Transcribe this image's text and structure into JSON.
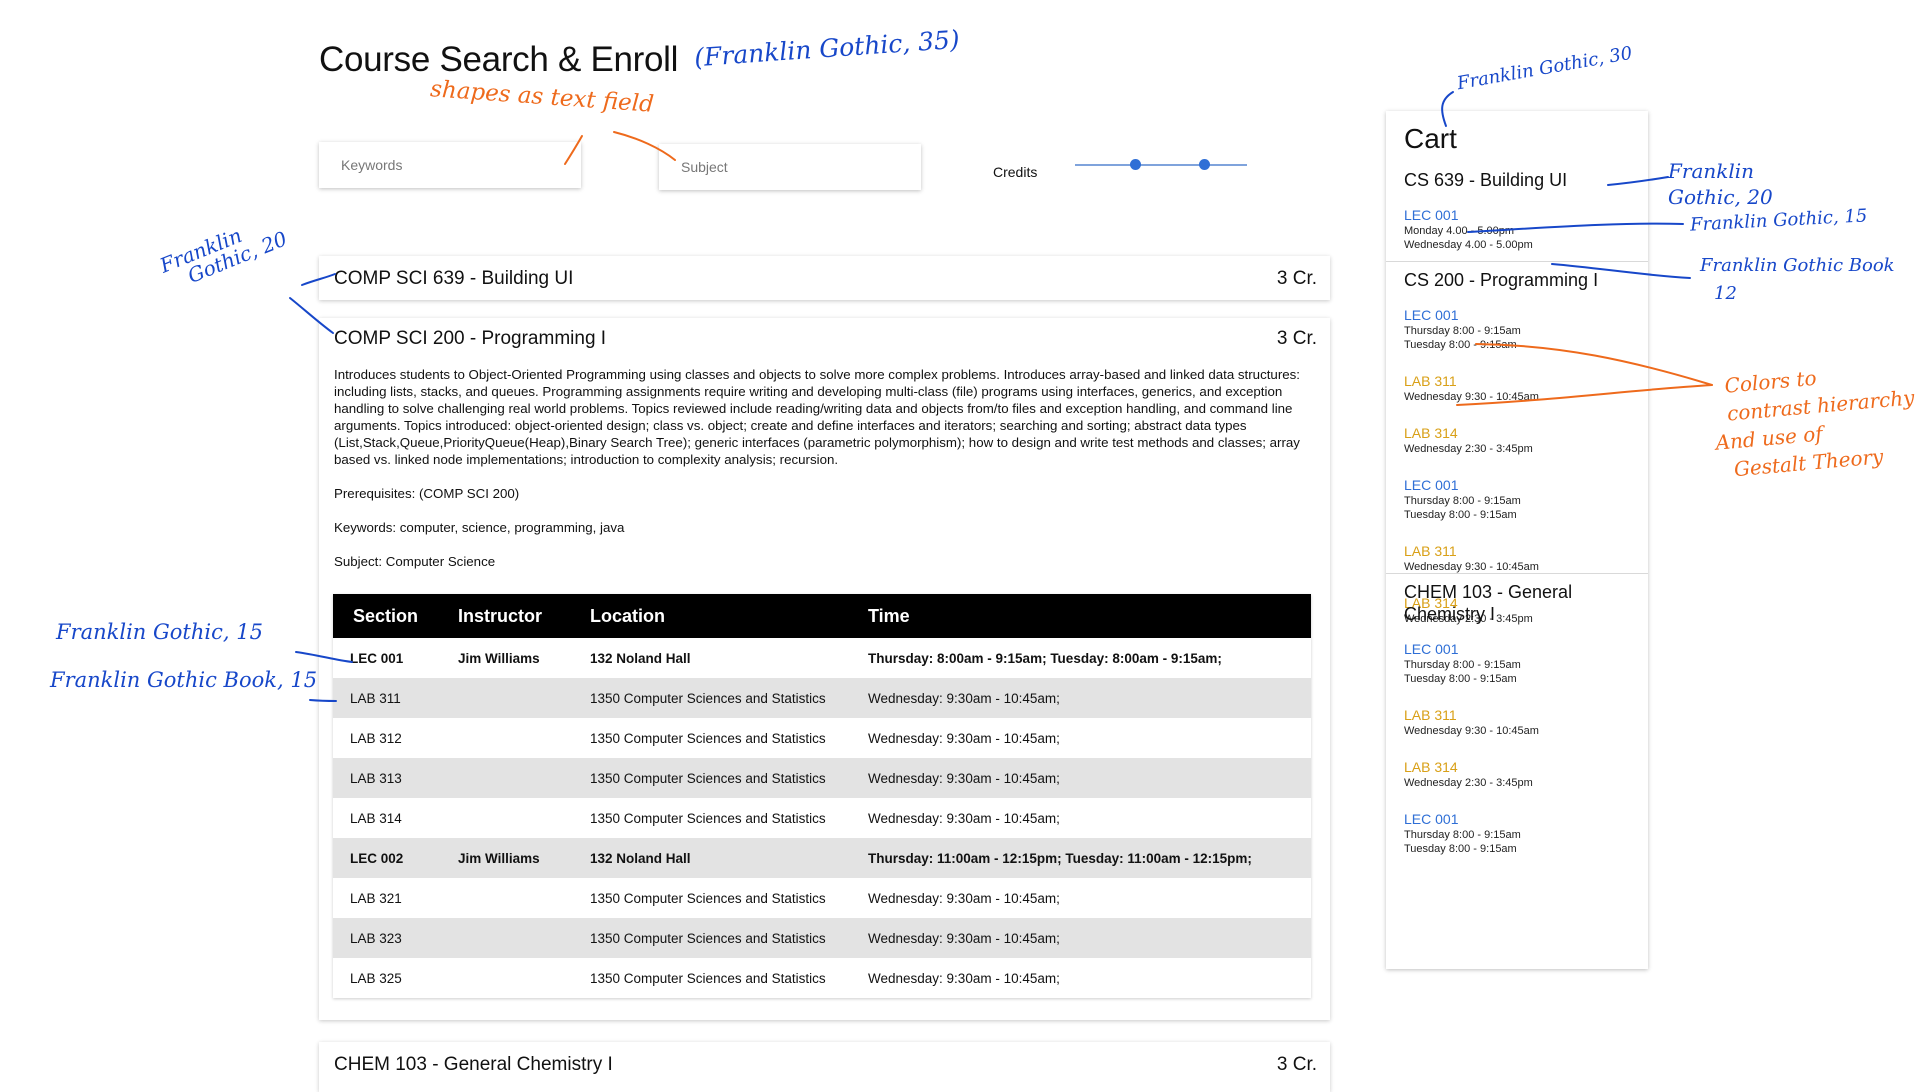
{
  "page": {
    "title": "Course Search & Enroll",
    "keywords_placeholder": "Keywords",
    "subject_placeholder": "Subject",
    "credits_label": "Credits",
    "credits_range": [
      0.35,
      0.75
    ]
  },
  "courses": [
    {
      "name": "COMP SCI 639 - Building UI",
      "credits": "3 Cr."
    },
    {
      "name": "COMP SCI 200 - Programming I",
      "credits": "3 Cr.",
      "description": "Introduces students to Object-Oriented Programming using classes and objects to solve more complex problems. Introduces array-based and linked data structures: including lists, stacks, and queues. Programming assignments require writing and developing multi-class (file) programs using interfaces, generics, and exception handling to solve challenging real world problems. Topics reviewed include reading/writing data and objects from/to files and exception handling, and command line arguments. Topics introduced: object-oriented design; class vs. object; create and define interfaces and iterators; searching and sorting; abstract data types (List,Stack,Queue,PriorityQueue(Heap),Binary Search Tree); generic interfaces (parametric polymorphism); how to design and write test methods and classes; array based vs. linked node implementations; introduction to complexity analysis; recursion.",
      "prerequisites": "Prerequisites: (COMP SCI 200)",
      "keywords": "Keywords: computer, science, programming, java",
      "subject": "Subject: Computer Science",
      "table_headers": [
        "Section",
        "Instructor",
        "Location",
        "Time"
      ],
      "sections": [
        {
          "section": "LEC 001",
          "instructor": "Jim Williams",
          "location": "132 Noland Hall",
          "time": "Thursday: 8:00am - 9:15am; Tuesday: 8:00am - 9:15am;"
        },
        {
          "section": "LAB 311",
          "instructor": "",
          "location": "1350 Computer Sciences and Statistics",
          "time": "Wednesday: 9:30am - 10:45am;"
        },
        {
          "section": "LAB 312",
          "instructor": "",
          "location": "1350 Computer Sciences and Statistics",
          "time": "Wednesday: 9:30am - 10:45am;"
        },
        {
          "section": "LAB 313",
          "instructor": "",
          "location": "1350 Computer Sciences and Statistics",
          "time": "Wednesday: 9:30am - 10:45am;"
        },
        {
          "section": "LAB 314",
          "instructor": "",
          "location": "1350 Computer Sciences and Statistics",
          "time": "Wednesday: 9:30am - 10:45am;"
        },
        {
          "section": "LEC 002",
          "instructor": "Jim Williams",
          "location": "132 Noland Hall",
          "time": "Thursday: 11:00am - 12:15pm; Tuesday: 11:00am - 12:15pm;"
        },
        {
          "section": "LAB 321",
          "instructor": "",
          "location": "1350 Computer Sciences and Statistics",
          "time": "Wednesday: 9:30am - 10:45am;"
        },
        {
          "section": "LAB 323",
          "instructor": "",
          "location": "1350 Computer Sciences and Statistics",
          "time": "Wednesday: 9:30am - 10:45am;"
        },
        {
          "section": "LAB 325",
          "instructor": "",
          "location": "1350 Computer Sciences and Statistics",
          "time": "Wednesday: 9:30am - 10:45am;"
        }
      ]
    },
    {
      "name": "CHEM 103 - General Chemistry I",
      "credits": "3 Cr."
    }
  ],
  "cart": {
    "title": "Cart",
    "courses": [
      {
        "name": "CS 639 - Building UI",
        "items": [
          {
            "code": "LEC 001",
            "kind": "lec",
            "times": [
              "Monday 4.00 - 5.00pm",
              "Wednesday 4.00 - 5.00pm"
            ]
          }
        ]
      },
      {
        "name": "CS 200 - Programming I",
        "items": [
          {
            "code": "LEC 001",
            "kind": "lec",
            "times": [
              "Thursday 8:00 - 9:15am",
              "Tuesday 8:00 - 9:15am"
            ]
          },
          {
            "code": "LAB 311",
            "kind": "lab",
            "times": [
              "Wednesday 9:30 - 10:45am"
            ]
          },
          {
            "code": "LAB 314",
            "kind": "lab",
            "times": [
              "Wednesday 2:30 - 3:45pm"
            ]
          },
          {
            "code": "LEC 001",
            "kind": "lec",
            "times": [
              "Thursday 8:00 - 9:15am",
              "Tuesday 8:00 - 9:15am"
            ]
          },
          {
            "code": "LAB 311",
            "kind": "lab",
            "times": [
              "Wednesday 9:30 - 10:45am"
            ]
          },
          {
            "code": "LAB 314",
            "kind": "lab",
            "times": [
              "Wednesday 2:30 - 3:45pm"
            ]
          }
        ]
      },
      {
        "name": "CHEM 103 - General Chemistry I",
        "items": [
          {
            "code": "LEC 001",
            "kind": "lec",
            "times": [
              "Thursday 8:00 - 9:15am",
              "Tuesday 8:00 - 9:15am"
            ]
          },
          {
            "code": "LAB 311",
            "kind": "lab",
            "times": [
              "Wednesday 9:30 - 10:45am"
            ]
          },
          {
            "code": "LAB 314",
            "kind": "lab",
            "times": [
              "Wednesday 2:30 - 3:45pm"
            ]
          },
          {
            "code": "LEC 001",
            "kind": "lec",
            "times": [
              "Thursday 8:00 - 9:15am",
              "Tuesday 8:00 - 9:15am"
            ]
          }
        ]
      }
    ]
  },
  "colors": {
    "lecture": "#2f6fd6",
    "lab": "#d9a017",
    "table_header_bg": "#000000",
    "annotation_blue": "#1747c9",
    "annotation_orange": "#ee6a1c"
  },
  "annotations": {
    "title_font": "(Franklin Gothic, 35)",
    "text_field_note": "shapes as text field",
    "cart_font": "Franklin Gothic, 30",
    "card_font_line1": "Franklin",
    "card_font_line2": "Gothic, 20",
    "cart_course_line1": "Franklin",
    "cart_course_line2": "Gothic, 20",
    "cart_code_font": "Franklin Gothic, 15",
    "cart_time_line1": "Franklin Gothic Book",
    "cart_time_line2": "12",
    "colors_line1": "Colors to",
    "colors_line2": "contrast hierarchy",
    "colors_line3": "And use of",
    "colors_line4": "Gestalt Theory",
    "section_font": "Franklin Gothic, 15",
    "section_book_font": "Franklin Gothic Book, 15"
  }
}
